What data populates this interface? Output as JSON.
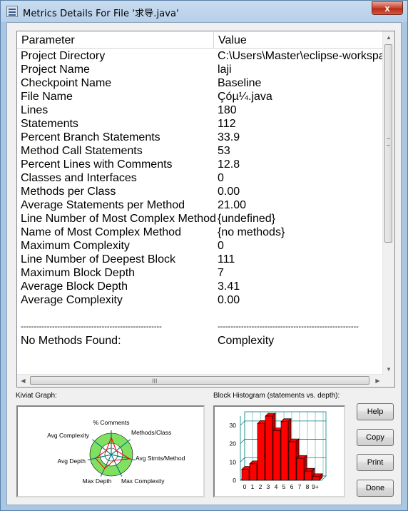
{
  "window": {
    "title": "Metrics Details For File '求导.java'",
    "close_glyph": "x"
  },
  "table": {
    "headers": {
      "parameter": "Parameter",
      "value": "Value"
    },
    "rows": [
      {
        "parameter": "Project Directory",
        "value": "C:\\Users\\Master\\eclipse-workspac"
      },
      {
        "parameter": "Project Name",
        "value": "laji"
      },
      {
        "parameter": "Checkpoint Name",
        "value": "Baseline"
      },
      {
        "parameter": "File Name",
        "value": "Çóµ¼.java"
      },
      {
        "parameter": "Lines",
        "value": "180"
      },
      {
        "parameter": "Statements",
        "value": "112"
      },
      {
        "parameter": "Percent Branch Statements",
        "value": "33.9"
      },
      {
        "parameter": "Method Call Statements",
        "value": "53"
      },
      {
        "parameter": "Percent Lines with Comments",
        "value": "12.8"
      },
      {
        "parameter": "Classes and Interfaces",
        "value": "0"
      },
      {
        "parameter": "Methods per Class",
        "value": "0.00"
      },
      {
        "parameter": "Average Statements per Method",
        "value": "21.00"
      },
      {
        "parameter": "Line Number of Most Complex Method",
        "value": "{undefined}"
      },
      {
        "parameter": "Name of Most Complex Method",
        "value": "{no methods}"
      },
      {
        "parameter": "Maximum Complexity",
        "value": "0"
      },
      {
        "parameter": "Line Number of Deepest Block",
        "value": "111"
      },
      {
        "parameter": "Maximum Block Depth",
        "value": "7"
      },
      {
        "parameter": "Average Block Depth",
        "value": "3.41"
      },
      {
        "parameter": "Average Complexity",
        "value": "0.00"
      },
      {
        "parameter": "",
        "value": ""
      },
      {
        "parameter": "------------------------------------------------------",
        "value": "------------------------------------------------------"
      },
      {
        "parameter": "No Methods Found:",
        "value": "Complexity"
      }
    ],
    "hscroll_grip": "III"
  },
  "kiviat": {
    "label": "Kiviat Graph:",
    "axes": [
      "% Comments",
      "Methods/Class",
      "Avg Stmts/Method",
      "Max Complexity",
      "Max Depth",
      "Avg Depth",
      "Avg Complexity"
    ],
    "values": [
      0.6,
      0.0,
      0.7,
      0.0,
      0.5,
      0.55,
      0.0
    ],
    "colors": {
      "ring": "#80e060",
      "spoke": "#008080",
      "value": "#ff0000"
    }
  },
  "histogram": {
    "label": "Block Histogram (statements vs. depth):",
    "y_ticks": [
      "0",
      "10",
      "20",
      "30"
    ],
    "x_labels": [
      "0",
      "1",
      "2",
      "3",
      "4",
      "5",
      "6",
      "7",
      "8",
      "9+"
    ],
    "ymax": 35,
    "values": [
      6,
      9,
      31,
      35,
      27,
      32,
      21,
      12,
      5,
      2
    ],
    "bar_color": "#ff0000",
    "grid_color": "#008080"
  },
  "buttons": {
    "help": "Help",
    "copy": "Copy",
    "print": "Print",
    "done": "Done"
  }
}
